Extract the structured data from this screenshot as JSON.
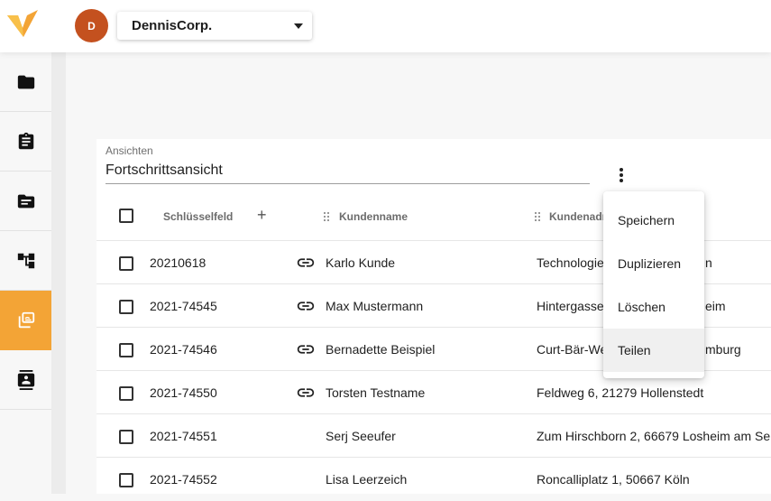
{
  "header": {
    "avatar_initial": "D",
    "company": "DennisCorp."
  },
  "sidebar": {
    "items": [
      {
        "icon": "folder-icon"
      },
      {
        "icon": "clipboard-icon"
      },
      {
        "icon": "document-folder-icon"
      },
      {
        "icon": "hierarchy-icon"
      },
      {
        "icon": "library-icon",
        "active": true
      },
      {
        "icon": "contact-card-icon"
      }
    ]
  },
  "views": {
    "label": "Ansichten",
    "value": "Fortschrittsansicht"
  },
  "table": {
    "headers": {
      "key": "Schlüsselfeld",
      "add": "+",
      "customer_name": "Kundenname",
      "customer_address": "Kundenadr"
    },
    "rows": [
      {
        "key": "20210618",
        "linked": true,
        "name": "Karlo Kunde",
        "address": "Technologie",
        "address_tail": "n"
      },
      {
        "key": "2021-74545",
        "linked": true,
        "name": "Max Mustermann",
        "address": "Hintergasse",
        "address_tail": "eim"
      },
      {
        "key": "2021-74546",
        "linked": true,
        "name": "Bernadette Beispiel",
        "address": "Curt-Bär-We",
        "address_tail": "mburg"
      },
      {
        "key": "2021-74550",
        "linked": true,
        "name": "Torsten Testname",
        "address": "Feldweg 6, 21279 Hollenstedt",
        "address_tail": ""
      },
      {
        "key": "2021-74551",
        "linked": false,
        "name": "Serj Seeufer",
        "address": "Zum Hirschborn 2, 66679 Losheim am Se",
        "address_tail": ""
      },
      {
        "key": "2021-74552",
        "linked": false,
        "name": "Lisa Leerzeich",
        "address": "Roncalliplatz 1, 50667 Köln",
        "address_tail": ""
      }
    ]
  },
  "menu": {
    "items": [
      "Speichern",
      "Duplizieren",
      "Löschen",
      "Teilen"
    ],
    "hovered": "Teilen"
  },
  "colors": {
    "accent": "#f3a436",
    "avatar": "#c4511f"
  }
}
